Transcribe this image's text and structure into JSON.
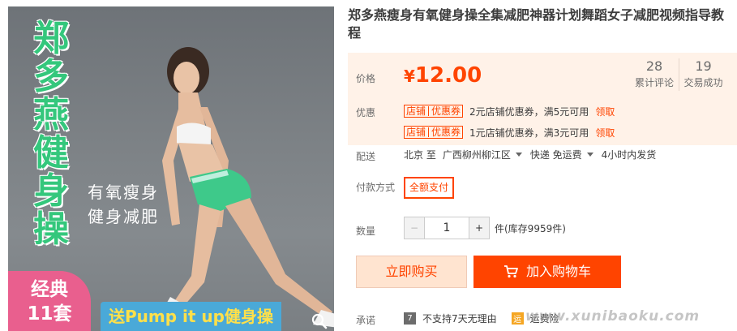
{
  "product_image": {
    "vertical_title": [
      "郑",
      "多",
      "燕",
      "健",
      "身",
      "操"
    ],
    "slogan": [
      "有氧瘦身",
      "健身减肥"
    ],
    "badge": [
      "经典",
      "11套"
    ],
    "bonus_text": "送Pump it up健身操"
  },
  "title": "郑多燕瘦身有氧健身操全集减肥神器计划舞蹈女子减肥视频指导教程",
  "price": {
    "label": "价格",
    "symbol": "¥",
    "value": "12.00"
  },
  "stats": [
    {
      "value": "28",
      "label": "累计评论"
    },
    {
      "value": "19",
      "label": "交易成功"
    }
  ],
  "promo": {
    "label": "优惠",
    "coupons": [
      {
        "tag_left": "店铺",
        "tag_right": "优惠券",
        "text": "2元店铺优惠券，满5元可用",
        "link": "领取"
      },
      {
        "tag_left": "店铺",
        "tag_right": "优惠券",
        "text": "1元店铺优惠券，满3元可用",
        "link": "领取"
      }
    ]
  },
  "shipping": {
    "label": "配送",
    "from": "北京 至",
    "to": "广西柳州柳江区",
    "method": "快递 免运费",
    "time": "4小时内发货"
  },
  "payment": {
    "label": "付款方式",
    "option": "全额支付"
  },
  "quantity": {
    "label": "数量",
    "minus": "−",
    "value": "1",
    "plus": "+",
    "unit": "件(库存9959件)"
  },
  "actions": {
    "buy_now": "立即购买",
    "add_to_cart": "加入购物车"
  },
  "promise": {
    "label": "承诺",
    "items": [
      {
        "icon_text": "7",
        "text": "不支持7天无理由"
      },
      {
        "icon_text": "运",
        "text": "运费险"
      }
    ]
  },
  "watermark": "www.xunibaoku.com",
  "colors": {
    "accent": "#ff4400",
    "price_bg": "#fff2e8",
    "title_green": "#34c77c",
    "badge_pink": "#e95f8e"
  }
}
